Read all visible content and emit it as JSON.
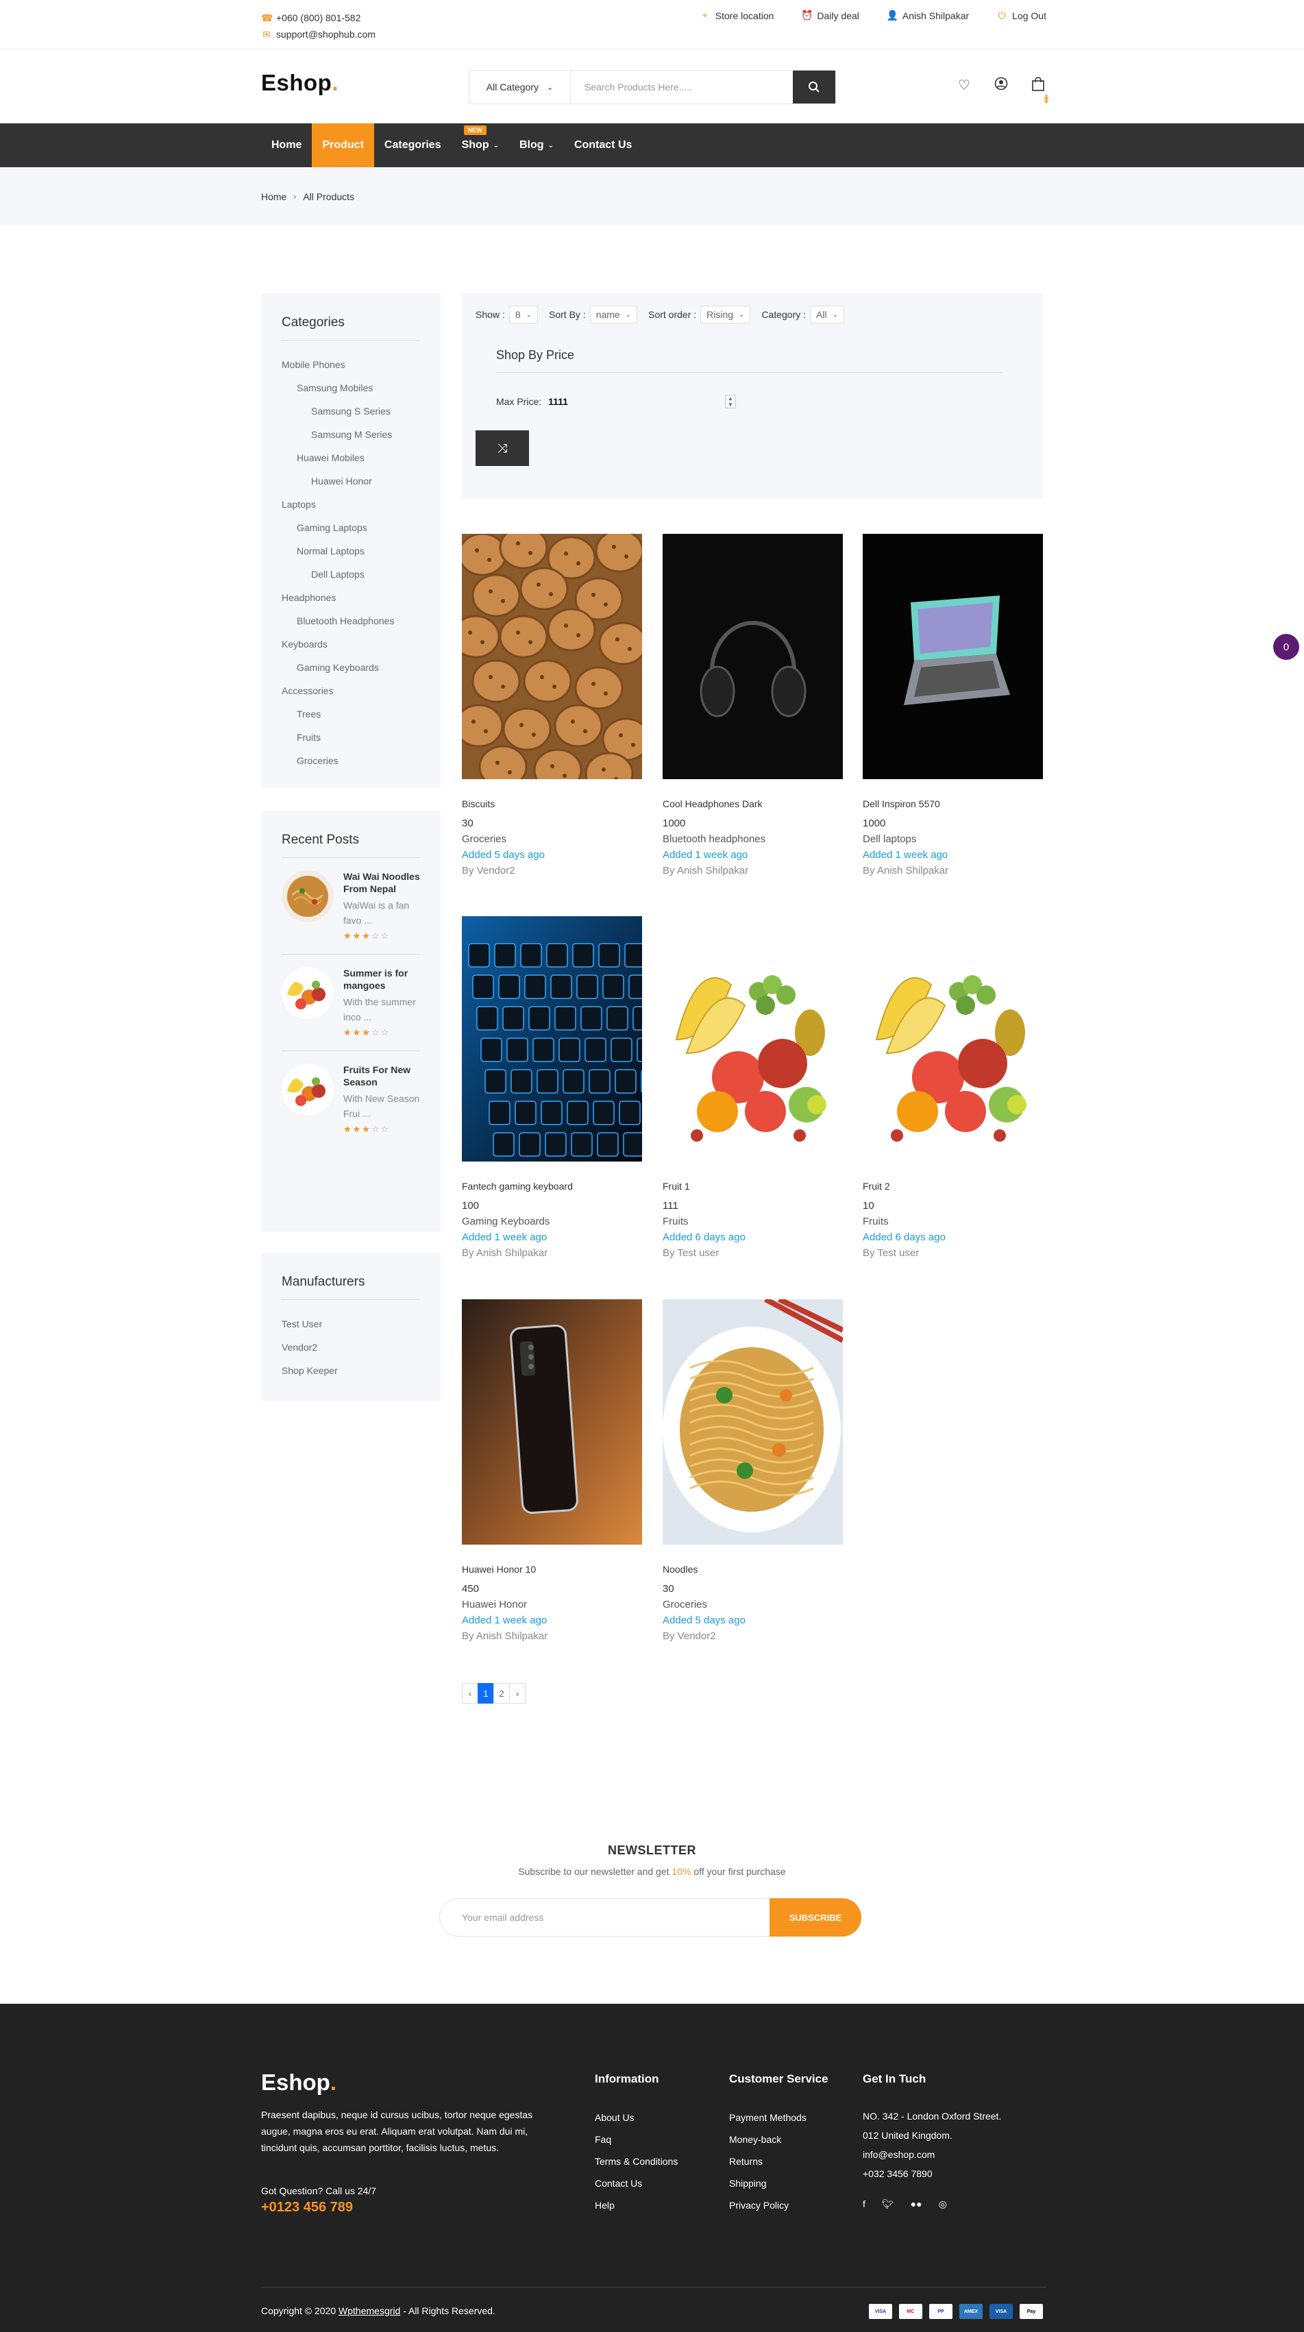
{
  "topbar": {
    "phone": "+060 (800) 801-582",
    "email": "support@shophub.com",
    "links": [
      "Store location",
      "Daily deal",
      "Anish Shilpakar",
      "Log Out"
    ]
  },
  "header": {
    "logo": "Eshop",
    "logo_dot": ".",
    "category_select": "All Category",
    "search_placeholder": "Search Products Here.....",
    "cart_count": "0"
  },
  "nav": {
    "items": [
      "Home",
      "Product",
      "Categories",
      "Shop",
      "Blog",
      "Contact Us"
    ],
    "new_badge": "NEW"
  },
  "breadcrumb": {
    "home": "Home",
    "current": "All Products"
  },
  "categories": {
    "title": "Categories",
    "items": [
      {
        "label": "Mobile Phones",
        "level": 1
      },
      {
        "label": "Samsung Mobiles",
        "level": 2
      },
      {
        "label": "Samsung S Series",
        "level": 3
      },
      {
        "label": "Samsung M Series",
        "level": 3
      },
      {
        "label": "Huawei Mobiles",
        "level": 2
      },
      {
        "label": "Huawei Honor",
        "level": 3
      },
      {
        "label": "Laptops",
        "level": 1
      },
      {
        "label": "Gaming Laptops",
        "level": 2
      },
      {
        "label": "Normal Laptops",
        "level": 2
      },
      {
        "label": "Dell Laptops",
        "level": 3
      },
      {
        "label": "Headphones",
        "level": 1
      },
      {
        "label": "Bluetooth Headphones",
        "level": 2
      },
      {
        "label": "Keyboards",
        "level": 1
      },
      {
        "label": "Gaming Keyboards",
        "level": 2
      },
      {
        "label": "Accessories",
        "level": 1
      },
      {
        "label": "Trees",
        "level": 2
      },
      {
        "label": "Fruits",
        "level": 2
      },
      {
        "label": "Groceries",
        "level": 2
      }
    ]
  },
  "recent_posts": {
    "title": "Recent Posts",
    "posts": [
      {
        "title": "Wai Wai Noodles From Nepal",
        "desc": "WaiWai is a fan favo ...",
        "rating": 3
      },
      {
        "title": "Summer is for mangoes",
        "desc": "With the summer inco ...",
        "rating": 3
      },
      {
        "title": "Fruits For New Season",
        "desc": "With New Season Frui ...",
        "rating": 3
      }
    ]
  },
  "manufacturers": {
    "title": "Manufacturers",
    "items": [
      "Test User",
      "Vendor2",
      "Shop Keeper"
    ]
  },
  "filter": {
    "show_label": "Show :",
    "show_value": "8",
    "sortby_label": "Sort By :",
    "sortby_value": "name",
    "order_label": "Sort order :",
    "order_value": "Rising",
    "category_label": "Category :",
    "category_value": "All",
    "price_title": "Shop By Price",
    "max_price_label": "Max Price:",
    "max_price_value": "1111"
  },
  "products": [
    {
      "name": "Biscuits",
      "price": "30",
      "category": "Groceries",
      "added": "Added 5 days ago",
      "by": "By Vendor2",
      "icon": "biscuits-image"
    },
    {
      "name": "Cool Headphones Dark",
      "price": "1000",
      "category": "Bluetooth headphones",
      "added": "Added 1 week ago",
      "by": "By Anish Shilpakar",
      "icon": "headphones-image"
    },
    {
      "name": "Dell Inspiron 5570",
      "price": "1000",
      "category": "Dell laptops",
      "added": "Added 1 week ago",
      "by": "By Anish Shilpakar",
      "icon": "laptop-image"
    },
    {
      "name": "Fantech gaming keyboard",
      "price": "100",
      "category": "Gaming Keyboards",
      "added": "Added 1 week ago",
      "by": "By Anish Shilpakar",
      "icon": "keyboard-image"
    },
    {
      "name": "Fruit 1",
      "price": "111",
      "category": "Fruits",
      "added": "Added 6 days ago",
      "by": "By Test user",
      "icon": "fruits-image"
    },
    {
      "name": "Fruit 2",
      "price": "10",
      "category": "Fruits",
      "added": "Added 6 days ago",
      "by": "By Test user",
      "icon": "fruits-image"
    },
    {
      "name": "Huawei Honor 10",
      "price": "450",
      "category": "Huawei Honor",
      "added": "Added 1 week ago",
      "by": "By Anish Shilpakar",
      "icon": "phone-image"
    },
    {
      "name": "Noodles",
      "price": "30",
      "category": "Groceries",
      "added": "Added 5 days ago",
      "by": "By Vendor2",
      "icon": "noodles-image"
    }
  ],
  "pagination": {
    "prev": "‹",
    "pages": [
      "1",
      "2"
    ],
    "next": "›",
    "current": "1"
  },
  "floating_badge": "0",
  "newsletter": {
    "title": "NEWSLETTER",
    "text_before": "Subscribe to our newsletter and get ",
    "highlight": "10%",
    "text_after": " off your first purchase",
    "placeholder": "Your email address",
    "button": "SUBSCRIBE"
  },
  "footer": {
    "logo": "Eshop",
    "logo_dot": ".",
    "about": "Praesent dapibus, neque id cursus ucibus, tortor neque egestas augue, magna eros eu erat. Aliquam erat volutpat. Nam dui mi, tincidunt quis, accumsan porttitor, facilisis luctus, metus.",
    "question": "Got Question? Call us 24/7",
    "phone": "+0123 456 789",
    "information": {
      "title": "Information",
      "links": [
        "About Us",
        "Faq",
        "Terms & Conditions",
        "Contact Us",
        "Help"
      ]
    },
    "customer_service": {
      "title": "Customer Service",
      "links": [
        "Payment Methods",
        "Money-back",
        "Returns",
        "Shipping",
        "Privacy Policy"
      ]
    },
    "contact": {
      "title": "Get In Tuch",
      "lines": [
        "NO. 342 - London Oxford Street.",
        "012 United Kingdom.",
        "info@eshop.com",
        "+032 3456 7890"
      ]
    },
    "copyright_before": "Copyright © 2020 ",
    "copyright_link": "Wpthemesgrid",
    "copyright_after": " - All Rights Reserved.",
    "payments": [
      "VISA",
      "MC",
      "PP",
      "AMEX",
      "VISA",
      "Pay"
    ]
  },
  "colors": {
    "accent": "#F7941D",
    "dark": "#333333",
    "link_blue": "#1a9bd7"
  }
}
